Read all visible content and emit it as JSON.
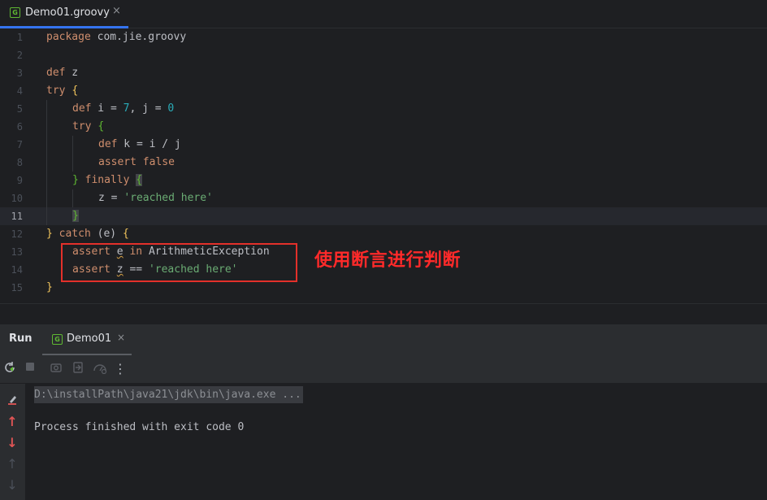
{
  "editor_tab": {
    "icon": "G",
    "label": "Demo01.groovy",
    "close": "×"
  },
  "gutter": {
    "line_numbers": [
      "1",
      "2",
      "3",
      "4",
      "5",
      "6",
      "7",
      "8",
      "9",
      "10",
      "11",
      "12",
      "13",
      "14",
      "15"
    ]
  },
  "code": {
    "l1": {
      "kw": "package",
      "rest": " com.jie.groovy"
    },
    "l3": {
      "kw": "def",
      "rest": " z"
    },
    "l4": {
      "kw": "try",
      "brace": "{"
    },
    "l5": {
      "kw": "def",
      "var1": " i = ",
      "n1": "7",
      "mid": ", j = ",
      "n2": "0"
    },
    "l6": {
      "kw": "try",
      "brace": "{"
    },
    "l7": {
      "kw": "def",
      "rest": " k = i / j"
    },
    "l8": {
      "kw": "assert",
      "val": "false"
    },
    "l9": {
      "close": "}",
      "kw": "finally",
      "brace": "{"
    },
    "l10": {
      "lhs": "z = ",
      "str": "'reached here'"
    },
    "l11": {
      "brace": "}"
    },
    "l12": {
      "close": "}",
      "kw": "catch",
      "rest": " (e) ",
      "brace": "{"
    },
    "l13": {
      "kw": "assert",
      "e": "e",
      "in": "in",
      "cls": "ArithmeticException"
    },
    "l14": {
      "kw": "assert",
      "z": "z",
      "op": " == ",
      "str": "'reached here'"
    },
    "l15": {
      "brace": "}"
    }
  },
  "annotation": {
    "text": "使用断言进行判断",
    "color": "#ff2a2a"
  },
  "run_panel": {
    "title": "Run",
    "tab_icon": "G",
    "tab_label": "Demo01",
    "tab_close": "×",
    "toolbar": [
      "rerun-icon",
      "stop-icon",
      "screenshot-icon",
      "export-icon",
      "profiler-icon",
      "more-icon"
    ],
    "side_tools": [
      "clear-icon",
      "up-arrow-icon",
      "down-arrow-icon",
      "scroll-up-icon",
      "scroll-down-icon"
    ],
    "console": {
      "command": "D:\\installPath\\java21\\jdk\\bin\\java.exe ...",
      "output": "Process finished with exit code 0"
    }
  },
  "colors": {
    "accent": "#3574f0",
    "keyword": "#cf8e6d",
    "string": "#6aab73",
    "number": "#2aacb8",
    "highlight_box": "#e3302a"
  }
}
